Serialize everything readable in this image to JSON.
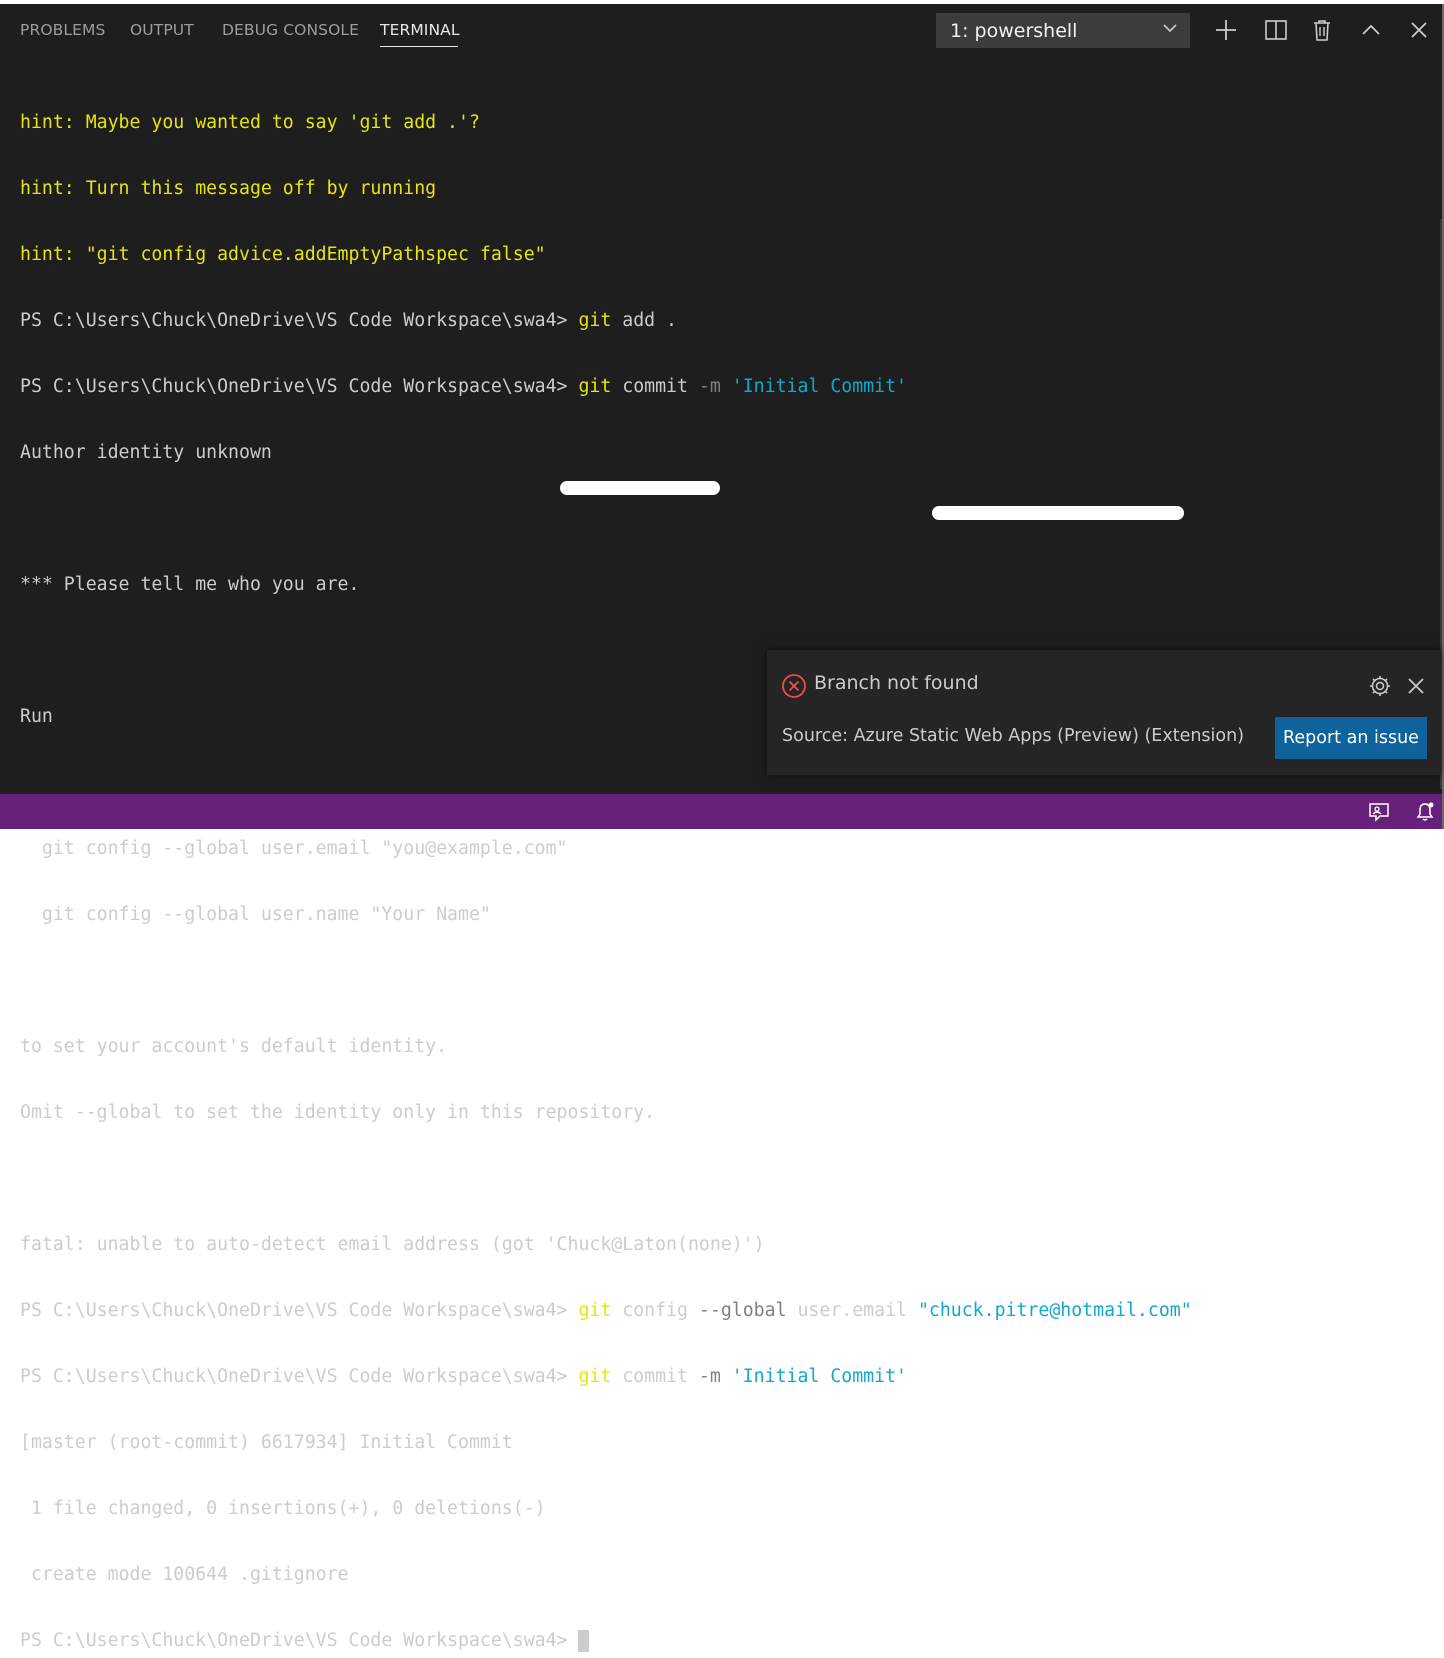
{
  "panel": {
    "tabs": [
      {
        "label": "PROBLEMS"
      },
      {
        "label": "OUTPUT"
      },
      {
        "label": "DEBUG CONSOLE"
      },
      {
        "label": "TERMINAL"
      }
    ],
    "active_tab": "TERMINAL",
    "terminal_select": "1: powershell"
  },
  "terminal": {
    "prompt": "PS C:\\Users\\Chuck\\OneDrive\\VS Code Workspace\\swa4>",
    "lines": {
      "hint1": "hint: Maybe you wanted to say 'git add .'?",
      "hint2": "hint: Turn this message off by running",
      "hint3": "hint: \"git config advice.addEmptyPathspec false\"",
      "cmd1_git": "git",
      "cmd1_rest": " add .",
      "cmd2_git": "git",
      "cmd2_a": " commit ",
      "cmd2_flag": "-m",
      "cmd2_str": "'Initial Commit'",
      "author": "Author identity unknown",
      "please": "*** Please tell me who you are.",
      "run": "Run",
      "cfg_email": "  git config --global user.email \"you@example.com\"",
      "cfg_name": "  git config --global user.name \"Your Name\"",
      "to_set": "to set your account's default identity.",
      "omit": "Omit --global to set the identity only in this repository.",
      "fatal_a": "fatal: unable to auto-detect email address (got '",
      "fatal_redacted": "Chuck@Laton(none",
      "fatal_b": ")')",
      "cmd3_git": "git",
      "cmd3_a": " config ",
      "cmd3_flag": "--global",
      "cmd3_b": " user.email ",
      "cmd3_str": "\"chuck.pitre@hotmail.com\"",
      "cmd4_git": "git",
      "cmd4_a": " commit ",
      "cmd4_flag": "-m",
      "cmd4_str": "'Initial Commit'",
      "out1": "[master (root-commit) 6617934] Initial Commit",
      "out2": " 1 file changed, 0 insertions(+), 0 deletions(-)",
      "out3": " create mode 100644 .gitignore"
    }
  },
  "notification": {
    "message": "Branch not found",
    "source": "Source: Azure Static Web Apps (Preview) (Extension)",
    "button": "Report an issue",
    "icon": "error-circle-icon"
  },
  "colors": {
    "background": "#1e1e1e",
    "statusbar": "#68217a",
    "button": "#0e639c",
    "hint": "#e5e510",
    "string": "#11a8cd",
    "error": "#f14c4c"
  }
}
